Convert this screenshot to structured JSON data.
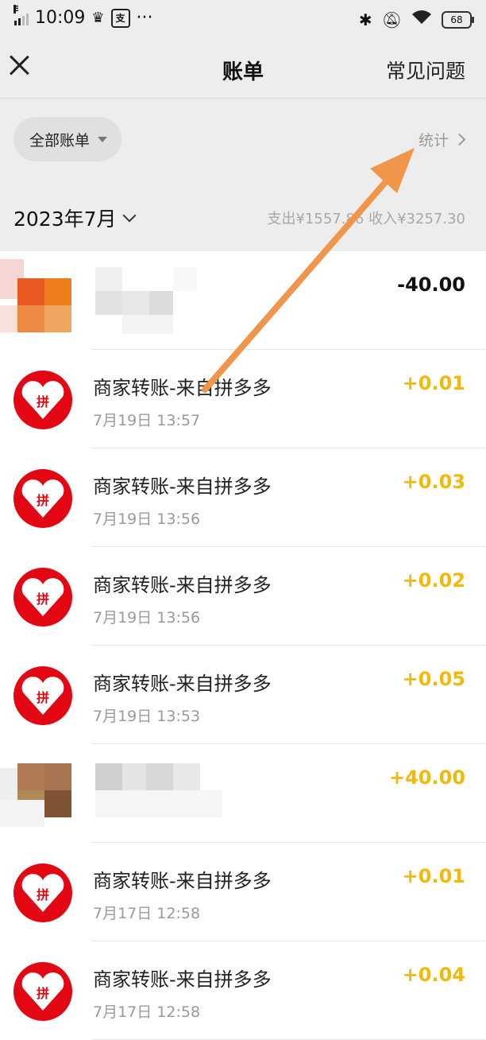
{
  "status_bar": {
    "time": "10:09",
    "battery": "68"
  },
  "header": {
    "title": "账单",
    "faq_label": "常见问题"
  },
  "filter": {
    "label": "全部账单",
    "stats_label": "统计"
  },
  "month_bar": {
    "month": "2023年7月",
    "summary": "支出¥1557.86 收入¥3257.30"
  },
  "transactions": [
    {
      "name": "",
      "time": "",
      "amount": "-40.00",
      "type": "expense",
      "icon": "blurred-avatar"
    },
    {
      "name": "商家转账-来自拼多多",
      "time": "7月19日 13:57",
      "amount": "+0.01",
      "type": "income",
      "icon": "pinduoduo-icon"
    },
    {
      "name": "商家转账-来自拼多多",
      "time": "7月19日 13:56",
      "amount": "+0.03",
      "type": "income",
      "icon": "pinduoduo-icon"
    },
    {
      "name": "商家转账-来自拼多多",
      "time": "7月19日 13:56",
      "amount": "+0.02",
      "type": "income",
      "icon": "pinduoduo-icon"
    },
    {
      "name": "商家转账-来自拼多多",
      "time": "7月19日 13:53",
      "amount": "+0.05",
      "type": "income",
      "icon": "pinduoduo-icon"
    },
    {
      "name": "",
      "time": "",
      "amount": "+40.00",
      "type": "income",
      "icon": "blurred-avatar"
    },
    {
      "name": "商家转账-来自拼多多",
      "time": "7月17日 12:58",
      "amount": "+0.01",
      "type": "income",
      "icon": "pinduoduo-icon"
    },
    {
      "name": "商家转账-来自拼多多",
      "time": "7月17日 12:58",
      "amount": "+0.04",
      "type": "income",
      "icon": "pinduoduo-icon"
    }
  ],
  "colors": {
    "income": "#f2b90d",
    "expense": "#111111",
    "brand_red": "#e30613",
    "annotation_arrow": "#f0954a",
    "background": "#ededed"
  }
}
